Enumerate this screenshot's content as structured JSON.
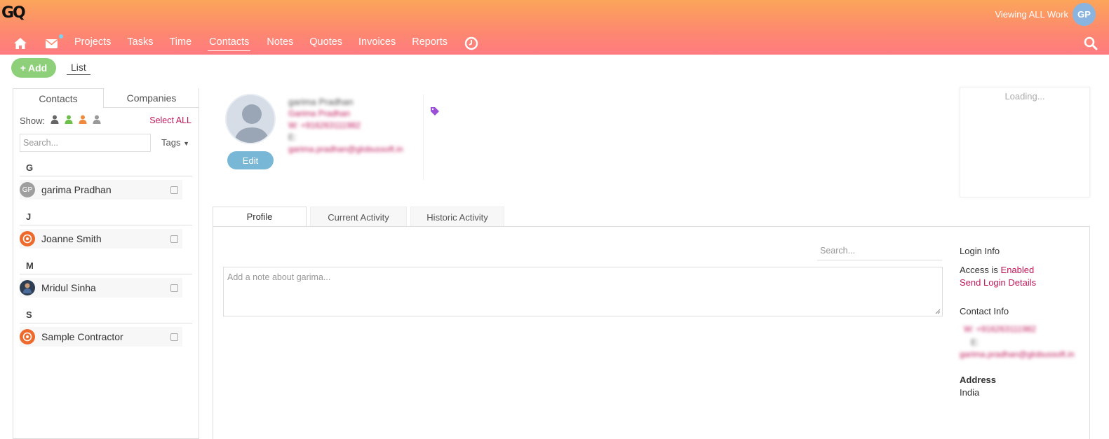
{
  "app": {
    "logo": "GQ",
    "viewing": "Viewing ALL Work",
    "user_initials": "GP"
  },
  "nav": {
    "items": [
      {
        "label": "Projects"
      },
      {
        "label": "Tasks"
      },
      {
        "label": "Time"
      },
      {
        "label": "Contacts"
      },
      {
        "label": "Notes"
      },
      {
        "label": "Quotes"
      },
      {
        "label": "Invoices"
      },
      {
        "label": "Reports"
      }
    ],
    "active": "Contacts"
  },
  "toolbar": {
    "add_label": "Add",
    "list_label": "List"
  },
  "left": {
    "tabs": [
      "Contacts",
      "Companies"
    ],
    "show_label": "Show:",
    "select_all": "Select ALL",
    "search_placeholder": "Search...",
    "tags_label": "Tags",
    "groups": [
      {
        "letter": "G",
        "contacts": [
          {
            "name": "garima Pradhan",
            "initials": "GP",
            "avatar": "initials"
          }
        ]
      },
      {
        "letter": "J",
        "contacts": [
          {
            "name": "Joanne Smith",
            "avatar": "orange-logo"
          }
        ]
      },
      {
        "letter": "M",
        "contacts": [
          {
            "name": "Mridul Sinha",
            "avatar": "photo"
          }
        ]
      },
      {
        "letter": "S",
        "contacts": [
          {
            "name": "Sample Contractor",
            "avatar": "orange-logo"
          }
        ]
      }
    ]
  },
  "profile": {
    "name": "garima Pradhan",
    "display_name": "Garima Pradhan",
    "work_phone": "W: +916263111982",
    "email_label": "E:",
    "email": "garima.pradhan@globussoft.in",
    "edit_label": "Edit",
    "loading": "Loading..."
  },
  "tabs": [
    "Profile",
    "Current Activity",
    "Historic Activity"
  ],
  "activity": {
    "search_placeholder": "Search...",
    "note_placeholder": "Add a note about garima..."
  },
  "info": {
    "login_title": "Login Info",
    "access_prefix": "Access is",
    "access_status": "Enabled",
    "send_login": "Send Login Details",
    "contact_title": "Contact Info",
    "contact_phone": "W: +916263111982",
    "contact_email_label": "E:",
    "contact_email": "garima.pradhan@globussoft.in",
    "address_title": "Address",
    "address_value": "India"
  },
  "colors": {
    "accent": "#c0185a",
    "add_green": "#8ed07a",
    "edit_blue": "#78b8d6",
    "tag_purple": "#9b4fd6"
  }
}
